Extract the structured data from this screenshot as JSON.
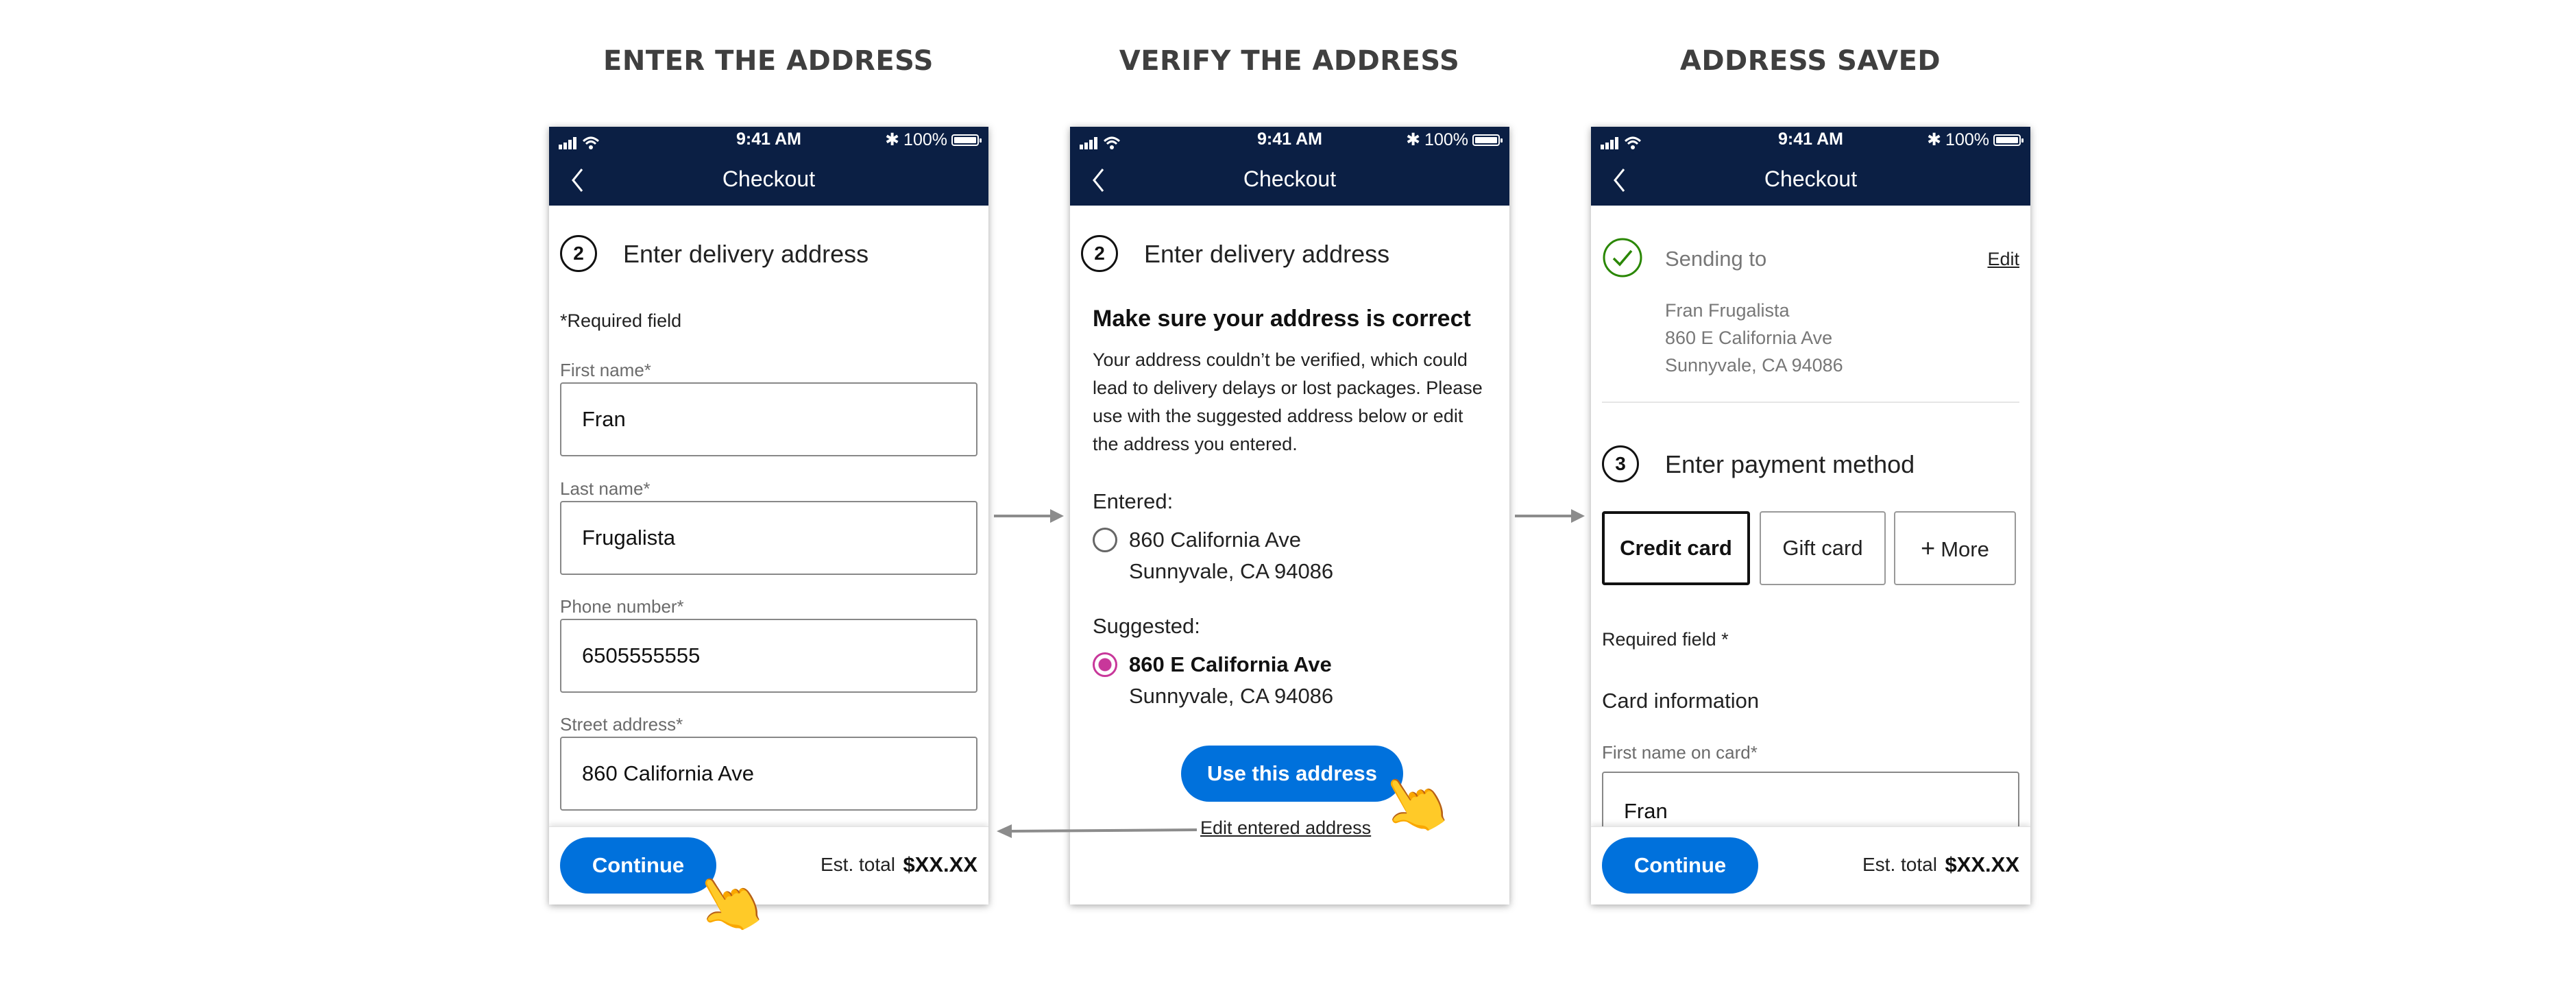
{
  "headings": [
    "ENTER THE ADDRESS",
    "VERIFY THE ADDRESS",
    "ADDRESS SAVED"
  ],
  "colors": {
    "navy": "#0b1f44",
    "primary": "#0071dc",
    "success": "#2a8703",
    "radio_selected": "#c8379a"
  },
  "status_bar": {
    "time": "9:41 AM",
    "battery": "100%",
    "icons": [
      "signal-icon",
      "wifi-icon",
      "bluetooth-icon",
      "battery-icon"
    ]
  },
  "header": {
    "title": "Checkout",
    "back_icon": "chevron-left-icon"
  },
  "screen1": {
    "step_number": "2",
    "step_title": "Enter delivery address",
    "required_note": "*Required field",
    "fields": [
      {
        "label": "First name*",
        "value": "Fran"
      },
      {
        "label": "Last name*",
        "value": "Frugalista"
      },
      {
        "label": "Phone number*",
        "value": "6505555555"
      },
      {
        "label": "Street address*",
        "value": "860 California Ave"
      }
    ],
    "continue_label": "Continue",
    "est_label": "Est. total",
    "est_value": "$XX.XX"
  },
  "screen2": {
    "step_number": "2",
    "step_title": "Enter delivery address",
    "verify_title": "Make sure your address is correct",
    "verify_body": [
      "Your address couldn’t be verified, which could",
      "lead to delivery delays or lost packages. Please",
      "use with the suggested address below or edit",
      "the address you entered."
    ],
    "entered_label": "Entered:",
    "entered_line1": "860 California Ave",
    "entered_line2": "Sunnyvale, CA 94086",
    "suggested_label": "Suggested:",
    "suggested_line1": "860 E California Ave",
    "suggested_line2": "Sunnyvale, CA 94086",
    "use_address_label": "Use this address",
    "edit_link": "Edit entered address"
  },
  "screen3": {
    "sending_to": "Sending to",
    "edit_label": "Edit",
    "address": [
      "Fran Frugalista",
      "860 E California Ave",
      "Sunnyvale, CA 94086"
    ],
    "step_number": "3",
    "step_title": "Enter payment method",
    "payment_options": [
      "Credit card",
      "Gift card",
      "More"
    ],
    "selected_payment": "Credit card",
    "required_note": "Required field *",
    "card_info_title": "Card information",
    "first_name_label": "First name on card*",
    "first_name_value": "Fran",
    "continue_label": "Continue",
    "est_label": "Est. total",
    "est_value": "$XX.XX"
  }
}
